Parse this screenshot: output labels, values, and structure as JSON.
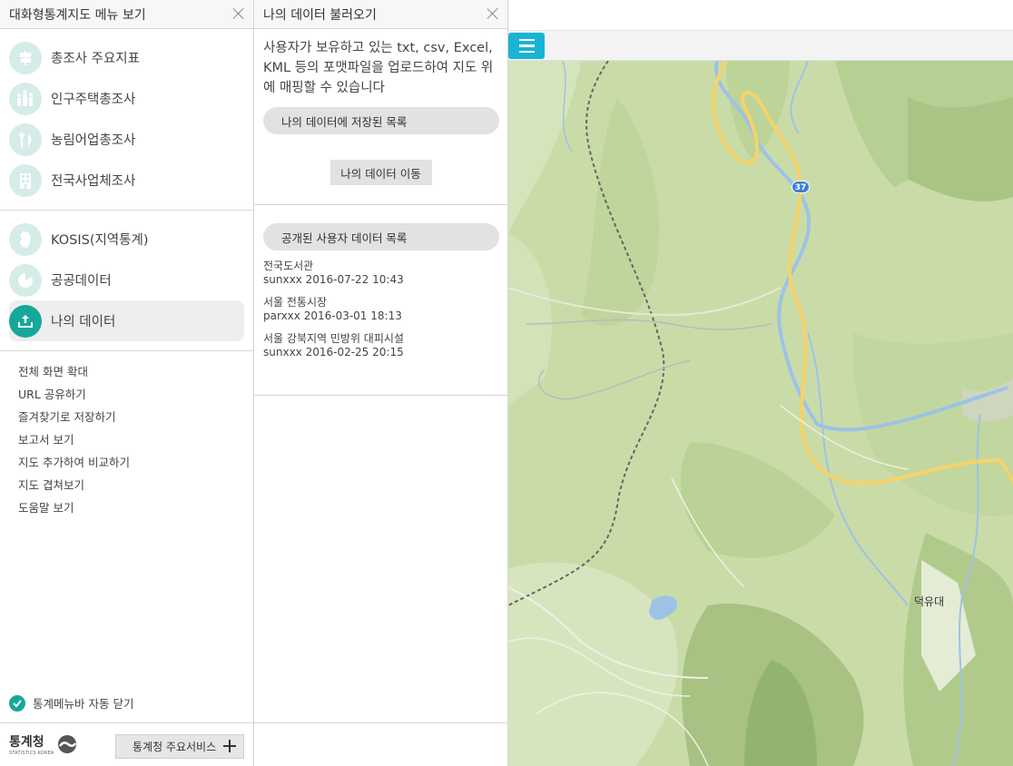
{
  "menu_panel": {
    "title": "대화형통계지도 메뉴 보기",
    "group1": [
      {
        "label": "총조사 주요지표",
        "icon": "signpost-icon"
      },
      {
        "label": "인구주택총조사",
        "icon": "population-icon"
      },
      {
        "label": "농림어업총조사",
        "icon": "agriculture-icon"
      },
      {
        "label": "전국사업체조사",
        "icon": "building-icon"
      }
    ],
    "group2": [
      {
        "label": "KOSIS(지역통계)",
        "icon": "korea-map-icon"
      },
      {
        "label": "공공데이터",
        "icon": "pie-chart-icon"
      },
      {
        "label": "나의 데이터",
        "icon": "upload-icon",
        "active": true
      }
    ],
    "links": [
      "전체 화면 확대",
      "URL 공유하기",
      "즐겨찾기로 저장하기",
      "보고서 보기",
      "지도 추가하여 비교하기",
      "지도 겹쳐보기",
      "도움말 보기"
    ],
    "auto_close_label": "통계메뉴바 자동 닫기",
    "logo_text": "통계청",
    "logo_sub": "STATISTICS KOREA",
    "service_button": "통계청 주요서비스"
  },
  "data_panel": {
    "title": "나의 데이터 불러오기",
    "description": "사용자가 보유하고 있는 txt, csv, Excel, KML 등의 포맷파일을 업로드하여 지도 위에 매핑할 수 있습니다",
    "saved_list_label": "나의 데이터에 저장된 목록",
    "move_button": "나의 데이터 이동",
    "public_list_label": "공개된 사용자 데이터 목록",
    "public_items": [
      {
        "title": "전국도서관",
        "meta": "sunxxx 2016-07-22 10:43"
      },
      {
        "title": "서울 전통시장",
        "meta": "parxxx 2016-03-01 18:13"
      },
      {
        "title": "서울 강북지역 민방위 대피시설",
        "meta": "sunxxx 2016-02-25 20:15"
      }
    ]
  },
  "map": {
    "place_label": "덕유대",
    "route_number": "37"
  },
  "colors": {
    "accent": "#17a89a",
    "menu_button": "#19b3d6",
    "map_bg": "#c9dca8",
    "road": "#f6d36a",
    "river": "#9ec2e6"
  }
}
